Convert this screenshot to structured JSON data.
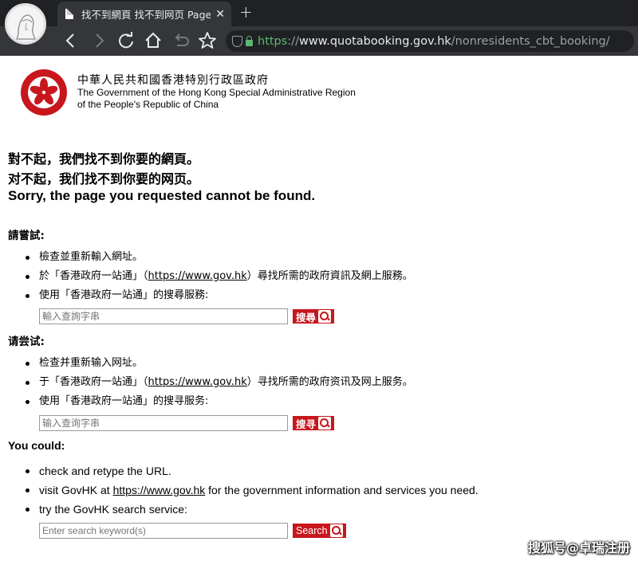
{
  "browser": {
    "tab_title": "找不到網頁 找不到网页 Page",
    "url_scheme": "https",
    "url_sep": "://",
    "url_host": "www.quotabooking.gov.hk",
    "url_path": "/nonresidents_cbt_booking/"
  },
  "header": {
    "name_zh": "中華人民共和國香港特別行政區政府",
    "name_en_1": "The Government of the Hong Kong Special Administrative Region",
    "name_en_2": "of the People's Republic of China"
  },
  "sorry": {
    "tc": "對不起，我們找不到你要的網頁。",
    "sc": "对不起，我们找不到你要的网页。",
    "en": "Sorry, the page you requested cannot be found."
  },
  "tc": {
    "heading": "請嘗試:",
    "item1": "檢查並重新輸入網址。",
    "item2_pre": "於「香港政府一站通」（",
    "item2_link": "https://www.gov.hk",
    "item2_post": "）尋找所需的政府資訊及網上服務。",
    "item3": "使用「香港政府一站通」的搜尋服務:",
    "placeholder": "輸入查詢字串",
    "button": "搜尋"
  },
  "sc": {
    "heading": "请尝试:",
    "item1": "检查并重新输入网址。",
    "item2_pre": "于「香港政府一站通」（",
    "item2_link": "https://www.gov.hk",
    "item2_post": "）寻找所需的政府资讯及网上服务。",
    "item3": "使用「香港政府一站通」的搜寻服务:",
    "placeholder": "输入查询字串",
    "button": "搜寻"
  },
  "en": {
    "heading": "You could:",
    "item1": "check and retype the URL.",
    "item2_pre": "visit GovHK at ",
    "item2_link": "https://www.gov.hk",
    "item2_post": " for the government information and services you need.",
    "item3": "try the GovHK search service:",
    "placeholder": "Enter search keyword(s)",
    "button": "Search"
  },
  "watermark": "搜狐号@卓瑞注册",
  "colors": {
    "accent_red": "#c8161d",
    "chrome_dark": "#202124",
    "chrome_toolbar": "#35363a",
    "secure_green": "#5bb974"
  },
  "icons": [
    "profile-avatar",
    "document-icon",
    "close-icon",
    "plus-icon",
    "back-arrow-icon",
    "forward-arrow-icon",
    "reload-icon",
    "home-icon",
    "undo-icon",
    "star-icon",
    "shield-icon",
    "lock-icon",
    "hksar-emblem",
    "magnifier-icon"
  ]
}
